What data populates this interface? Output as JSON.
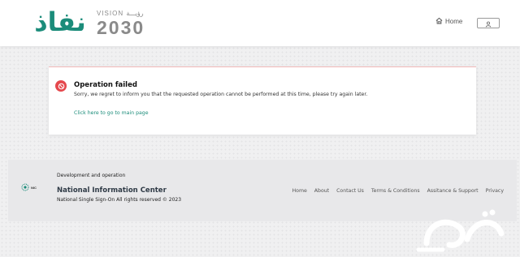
{
  "header": {
    "brand_logo_text": "نفاذ",
    "vision_top": "VISION رؤيـــة",
    "vision_year": "2030",
    "home_label": "Home",
    "icons": {
      "home": "home-icon",
      "user": "user-icon"
    }
  },
  "alert": {
    "title": "Operation failed",
    "message": "Sorry, we regret to inform you that the requested operation cannot be performed at this time, please try again later.",
    "link_text": "Click here to go to main page",
    "icon": "block-icon",
    "accent_color": "#e5484d"
  },
  "footer": {
    "dev_label": "Development and operation",
    "org_name": "National Information Center",
    "rights": "National Single Sign-On All rights reserved © 2023",
    "nic_logo_text": "NIC",
    "links": [
      "Home",
      "About",
      "Contact Us",
      "Terms & Conditions",
      "Assitance & Support",
      "Privacy"
    ]
  },
  "colors": {
    "brand": "#1b8c7a",
    "background": "#f0f0f1",
    "footer_bg": "#e8e8ea"
  }
}
